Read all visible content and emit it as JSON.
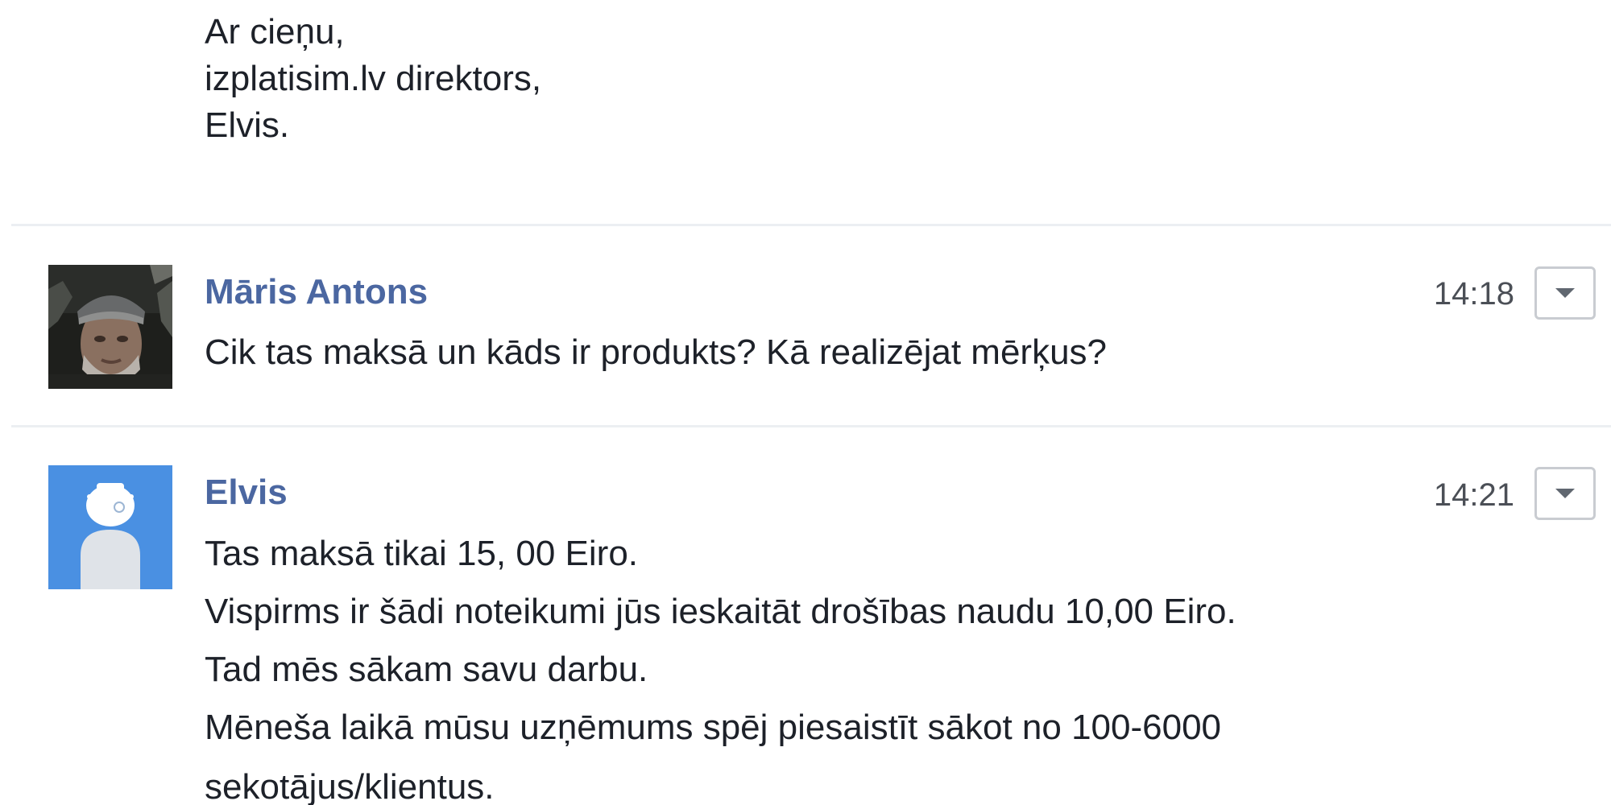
{
  "thread": {
    "signature": {
      "lines": [
        "Ar cieņu,",
        "izplatisim.lv direktors,",
        "Elvis."
      ]
    },
    "messages": [
      {
        "author": "Māris Antons",
        "time": "14:18",
        "lines": [
          "Cik tas maksā un kāds ir produkts? Kā realizējat mērķus?"
        ]
      },
      {
        "author": "Elvis",
        "time": "14:21",
        "lines": [
          "Tas maksā tikai 15, 00 Eiro.",
          "Vispirms ir šādi noteikumi jūs ieskaitāt drošības naudu 10,00 Eiro.",
          "Tad mēs sākam savu darbu.",
          "Mēneša laikā mūsu uzņēmums spēj piesaistīt sākot no 100-6000",
          "sekotājus/klientus."
        ]
      }
    ]
  },
  "icons": {
    "message_menu": "chevron-down-icon",
    "avatar_photo": "user-photo",
    "avatar_default": "default-user-icon"
  },
  "colors": {
    "author_name": "#4b67a1",
    "default_avatar_bg": "#4a90e2",
    "separator": "#eceff2"
  }
}
